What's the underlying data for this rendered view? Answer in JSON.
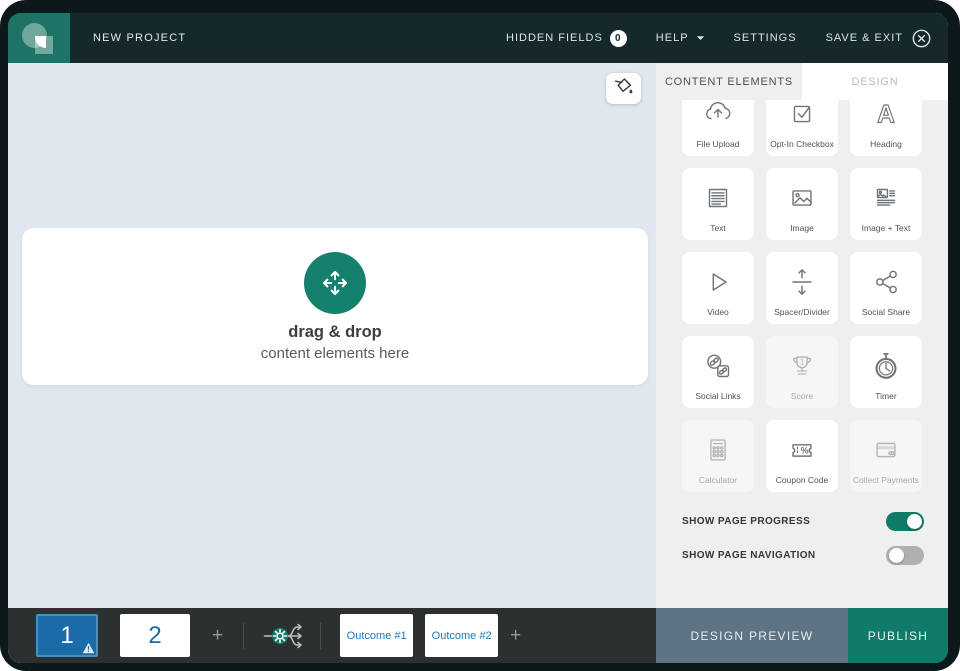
{
  "header": {
    "project_title": "NEW PROJECT",
    "hidden_fields_label": "HIDDEN FIELDS",
    "hidden_fields_count": "0",
    "help_label": "HELP",
    "settings_label": "SETTINGS",
    "save_exit_label": "SAVE & EXIT"
  },
  "canvas": {
    "dropzone_title": "drag & drop",
    "dropzone_subtitle": "content elements here",
    "paint_button_icon": "paint-bucket-icon",
    "dropzone_icon": "move-arrows-icon"
  },
  "sidebar": {
    "tabs": [
      {
        "label": "CONTENT ELEMENTS",
        "active": true
      },
      {
        "label": "DESIGN",
        "active": false
      }
    ],
    "elements": [
      {
        "label": "File Upload",
        "icon": "file-upload-icon",
        "disabled": false
      },
      {
        "label": "Opt-In Checkbox",
        "icon": "opt-in-checkbox-icon",
        "disabled": false
      },
      {
        "label": "Heading",
        "icon": "heading-icon",
        "disabled": false
      },
      {
        "label": "Text",
        "icon": "text-icon",
        "disabled": false
      },
      {
        "label": "Image",
        "icon": "image-icon",
        "disabled": false
      },
      {
        "label": "Image + Text",
        "icon": "image-text-icon",
        "disabled": false
      },
      {
        "label": "Video",
        "icon": "video-icon",
        "disabled": false
      },
      {
        "label": "Spacer/Divider",
        "icon": "spacer-divider-icon",
        "disabled": false
      },
      {
        "label": "Social Share",
        "icon": "social-share-icon",
        "disabled": false
      },
      {
        "label": "Social Links",
        "icon": "social-links-icon",
        "disabled": false
      },
      {
        "label": "Score",
        "icon": "score-icon",
        "disabled": true
      },
      {
        "label": "Timer",
        "icon": "timer-icon",
        "disabled": false
      },
      {
        "label": "Calculator",
        "icon": "calculator-icon",
        "disabled": true
      },
      {
        "label": "Coupon Code",
        "icon": "coupon-code-icon",
        "disabled": false
      },
      {
        "label": "Collect Payments",
        "icon": "collect-payments-icon",
        "disabled": true
      }
    ],
    "toggles": [
      {
        "label": "SHOW PAGE PROGRESS",
        "on": true
      },
      {
        "label": "SHOW PAGE NAVIGATION",
        "on": false
      }
    ]
  },
  "footer": {
    "pages": [
      {
        "label": "1",
        "active": true,
        "warning": true
      },
      {
        "label": "2",
        "active": false,
        "warning": false
      }
    ],
    "add_page_label": "+",
    "logic_icon": "branch-gear-icon",
    "outcomes": [
      {
        "label": "Outcome #1"
      },
      {
        "label": "Outcome #2"
      }
    ],
    "add_outcome_label": "+",
    "design_preview_label": "DESIGN PREVIEW",
    "publish_label": "PUBLISH"
  },
  "colors": {
    "accent_teal": "#0e7c69",
    "accent_blue": "#1a6ba7",
    "topbar": "#15292c",
    "canvas_bg": "#e1e7ee",
    "sidebar_bg": "#efefef",
    "bottombar_bg": "#2d3031",
    "design_preview_bg": "#5e7384"
  }
}
